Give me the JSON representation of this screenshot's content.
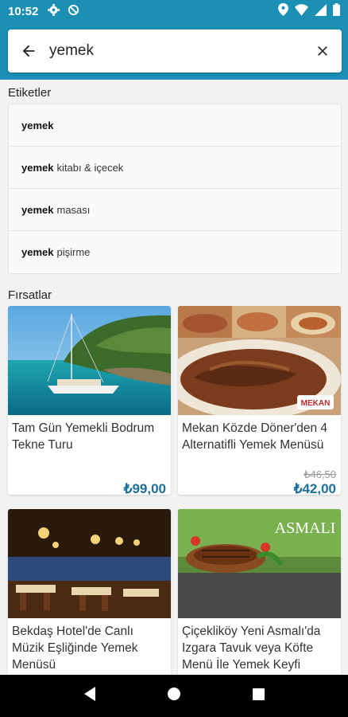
{
  "status": {
    "time": "10:52"
  },
  "search": {
    "value": "yemek",
    "placeholder": ""
  },
  "tags_section": {
    "title": "Etiketler",
    "items": [
      {
        "bold": "yemek",
        "rest": ""
      },
      {
        "bold": "yemek",
        "rest": "kitabı & içecek"
      },
      {
        "bold": "yemek",
        "rest": "masası"
      },
      {
        "bold": "yemek",
        "rest": "pişirme"
      }
    ]
  },
  "deals_section": {
    "title": "Fırsatlar",
    "cards": [
      {
        "title": "Tam Gün Yemekli Bodrum Tekne Turu",
        "price": "₺99,00",
        "old_price": ""
      },
      {
        "title": "Mekan Közde Döner'den 4 Alternatifli Yemek Menüsü",
        "price": "₺42,00",
        "old_price": "₺46,50",
        "logo_text": "MEKAN"
      },
      {
        "title": "Bekdaş Hotel'de Canlı Müzik Eşliğinde Yemek Menüsü",
        "price": "",
        "old_price": ""
      },
      {
        "title": "Çiçekliköy Yeni Asmalı'da Izgara Tavuk veya Köfte Menü İle Yemek Keyfi",
        "price": "",
        "old_price": "",
        "logo_text": "ASMALI"
      }
    ]
  },
  "colors": {
    "primary": "#1c8fb4",
    "price": "#1c6f9a"
  }
}
